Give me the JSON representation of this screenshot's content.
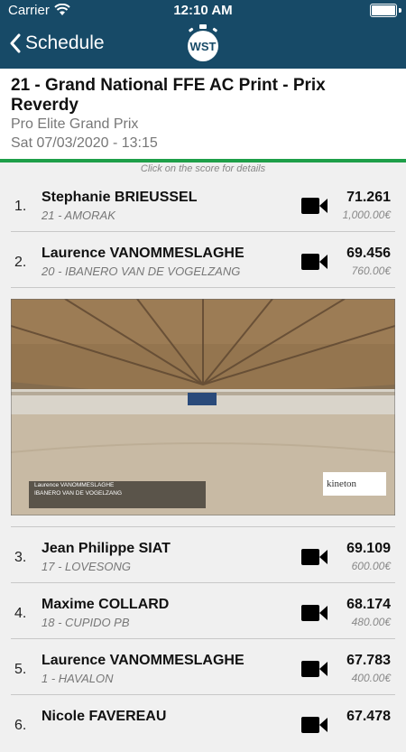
{
  "status": {
    "carrier": "Carrier",
    "time": "12:10 AM"
  },
  "nav": {
    "back_label": "Schedule",
    "logo_text": "WST"
  },
  "event": {
    "title": "21 -  Grand National FFE AC Print - Prix Reverdy",
    "subtitle": "Pro Elite Grand Prix",
    "datetime": "Sat 07/03/2020 - 13:15"
  },
  "hint": "Click on the score for details",
  "results": [
    {
      "rank": "1.",
      "rider": "Stephanie BRIEUSSEL",
      "horse": "21 - AMORAK",
      "score": "71.261",
      "prize": "1,000.00€"
    },
    {
      "rank": "2.",
      "rider": "Laurence VANOMMESLAGHE",
      "horse": "20 - IBANERO VAN DE VOGELZANG",
      "score": "69.456",
      "prize": "760.00€"
    },
    {
      "rank": "3.",
      "rider": "Jean Philippe SIAT",
      "horse": "17 - LOVESONG",
      "score": "69.109",
      "prize": "600.00€"
    },
    {
      "rank": "4.",
      "rider": "Maxime COLLARD",
      "horse": "18 - CUPIDO PB",
      "score": "68.174",
      "prize": "480.00€"
    },
    {
      "rank": "5.",
      "rider": "Laurence VANOMMESLAGHE",
      "horse": "1 - HAVALON",
      "score": "67.783",
      "prize": "400.00€"
    },
    {
      "rank": "6.",
      "rider": "Nicole FAVEREAU",
      "horse": "",
      "score": "67.478",
      "prize": ""
    }
  ],
  "video": {
    "overlay_rider": "Laurence VANOMMESLAGHE",
    "overlay_horse": "IBANERO VAN DE VOGELZANG",
    "overlay_brand": "kineton"
  },
  "colors": {
    "nav_bg": "#174a67",
    "accent": "#1e9f49"
  }
}
